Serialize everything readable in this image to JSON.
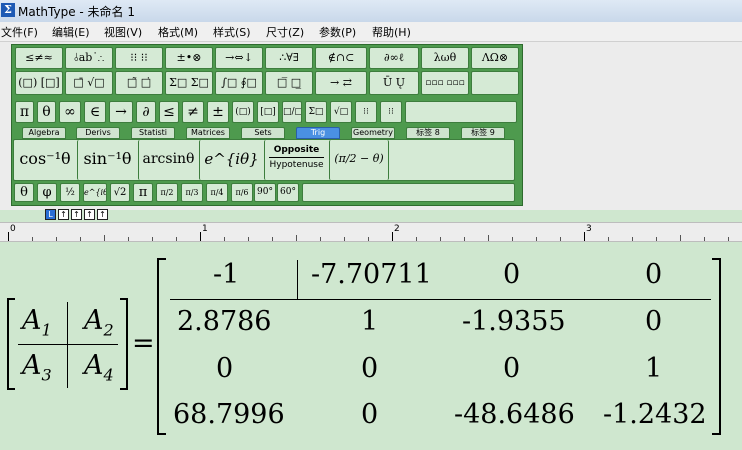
{
  "window": {
    "title": "MathType - 未命名 1",
    "app_icon_glyph": "Σ"
  },
  "menu": [
    "文件(F)",
    "编辑(E)",
    "视图(V)",
    "格式(M)",
    "样式(S)",
    "尺寸(Z)",
    "参数(P)",
    "帮助(H)"
  ],
  "palette_row1": [
    "≤≠≈",
    "⫰ab˙∴",
    "⁝⁝ ⁝⁝",
    "±•⊗",
    "→⇔↓",
    "∴∀∃",
    "∉∩⊂",
    "∂∞ℓ",
    "λωθ",
    "ΛΩ⊗"
  ],
  "palette_row2": [
    "(□) [□]",
    "□̄ √□",
    "□̃ □̇",
    "Σ□ Σ□",
    "∫□ ∮□",
    "□̅ □̲",
    "→ ⇄",
    "Ū Ų",
    "▫▫▫ ▫▫▫",
    ""
  ],
  "palette_row3": [
    "π",
    "θ",
    "∞",
    "∈",
    "→",
    "∂",
    "≤",
    "≠",
    "±",
    "(□)",
    "[□]",
    "□/□",
    "Σ□",
    "√□",
    "⁝⁝",
    "⁝⁝",
    ""
  ],
  "tabs": [
    "Algebra",
    "Derivs",
    "Statisti",
    "Matrices",
    "Sets",
    "Trig",
    "Geometry",
    "标签 8",
    "标签 9"
  ],
  "active_tab": "Trig",
  "trig_templates": {
    "t1": "cos⁻¹θ",
    "t2": "sin⁻¹θ",
    "t3": "arcsinθ",
    "t4": "e^{iθ}",
    "frac_num": "Opposite",
    "frac_den": "Hypotenuse",
    "t6": "(π/2 − θ)"
  },
  "small_row": [
    "θ",
    "φ",
    "½",
    "e^{iθ}",
    "√2",
    "π",
    "π/2",
    "π/3",
    "π/4",
    "π/6",
    "90°",
    "60°"
  ],
  "ruler_buttons": [
    "L",
    "↑",
    "↑",
    "↑",
    "↑"
  ],
  "ruler_numbers": [
    "0",
    "1",
    "2",
    "3"
  ],
  "equation": {
    "lhs": [
      [
        "A",
        "1"
      ],
      [
        "A",
        "2"
      ],
      [
        "A",
        "3"
      ],
      [
        "A",
        "4"
      ]
    ],
    "equals": "=",
    "matrix": [
      [
        "-1",
        "-7.70711",
        "0",
        "0"
      ],
      [
        "2.8786",
        "1",
        "-1.9355",
        "0"
      ],
      [
        "0",
        "0",
        "0",
        "1"
      ],
      [
        "68.7996",
        "0",
        "-48.6486",
        "-1.2432"
      ]
    ]
  }
}
